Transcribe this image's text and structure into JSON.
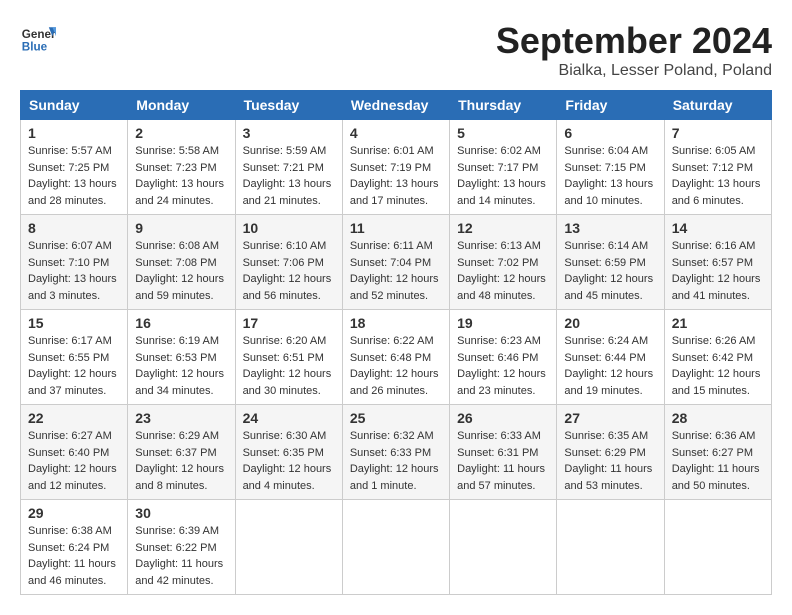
{
  "logo": {
    "general": "General",
    "blue": "Blue"
  },
  "header": {
    "month": "September 2024",
    "location": "Bialka, Lesser Poland, Poland"
  },
  "weekdays": [
    "Sunday",
    "Monday",
    "Tuesday",
    "Wednesday",
    "Thursday",
    "Friday",
    "Saturday"
  ],
  "weeks": [
    [
      {
        "day": "1",
        "info": "Sunrise: 5:57 AM\nSunset: 7:25 PM\nDaylight: 13 hours\nand 28 minutes."
      },
      {
        "day": "2",
        "info": "Sunrise: 5:58 AM\nSunset: 7:23 PM\nDaylight: 13 hours\nand 24 minutes."
      },
      {
        "day": "3",
        "info": "Sunrise: 5:59 AM\nSunset: 7:21 PM\nDaylight: 13 hours\nand 21 minutes."
      },
      {
        "day": "4",
        "info": "Sunrise: 6:01 AM\nSunset: 7:19 PM\nDaylight: 13 hours\nand 17 minutes."
      },
      {
        "day": "5",
        "info": "Sunrise: 6:02 AM\nSunset: 7:17 PM\nDaylight: 13 hours\nand 14 minutes."
      },
      {
        "day": "6",
        "info": "Sunrise: 6:04 AM\nSunset: 7:15 PM\nDaylight: 13 hours\nand 10 minutes."
      },
      {
        "day": "7",
        "info": "Sunrise: 6:05 AM\nSunset: 7:12 PM\nDaylight: 13 hours\nand 6 minutes."
      }
    ],
    [
      {
        "day": "8",
        "info": "Sunrise: 6:07 AM\nSunset: 7:10 PM\nDaylight: 13 hours\nand 3 minutes."
      },
      {
        "day": "9",
        "info": "Sunrise: 6:08 AM\nSunset: 7:08 PM\nDaylight: 12 hours\nand 59 minutes."
      },
      {
        "day": "10",
        "info": "Sunrise: 6:10 AM\nSunset: 7:06 PM\nDaylight: 12 hours\nand 56 minutes."
      },
      {
        "day": "11",
        "info": "Sunrise: 6:11 AM\nSunset: 7:04 PM\nDaylight: 12 hours\nand 52 minutes."
      },
      {
        "day": "12",
        "info": "Sunrise: 6:13 AM\nSunset: 7:02 PM\nDaylight: 12 hours\nand 48 minutes."
      },
      {
        "day": "13",
        "info": "Sunrise: 6:14 AM\nSunset: 6:59 PM\nDaylight: 12 hours\nand 45 minutes."
      },
      {
        "day": "14",
        "info": "Sunrise: 6:16 AM\nSunset: 6:57 PM\nDaylight: 12 hours\nand 41 minutes."
      }
    ],
    [
      {
        "day": "15",
        "info": "Sunrise: 6:17 AM\nSunset: 6:55 PM\nDaylight: 12 hours\nand 37 minutes."
      },
      {
        "day": "16",
        "info": "Sunrise: 6:19 AM\nSunset: 6:53 PM\nDaylight: 12 hours\nand 34 minutes."
      },
      {
        "day": "17",
        "info": "Sunrise: 6:20 AM\nSunset: 6:51 PM\nDaylight: 12 hours\nand 30 minutes."
      },
      {
        "day": "18",
        "info": "Sunrise: 6:22 AM\nSunset: 6:48 PM\nDaylight: 12 hours\nand 26 minutes."
      },
      {
        "day": "19",
        "info": "Sunrise: 6:23 AM\nSunset: 6:46 PM\nDaylight: 12 hours\nand 23 minutes."
      },
      {
        "day": "20",
        "info": "Sunrise: 6:24 AM\nSunset: 6:44 PM\nDaylight: 12 hours\nand 19 minutes."
      },
      {
        "day": "21",
        "info": "Sunrise: 6:26 AM\nSunset: 6:42 PM\nDaylight: 12 hours\nand 15 minutes."
      }
    ],
    [
      {
        "day": "22",
        "info": "Sunrise: 6:27 AM\nSunset: 6:40 PM\nDaylight: 12 hours\nand 12 minutes."
      },
      {
        "day": "23",
        "info": "Sunrise: 6:29 AM\nSunset: 6:37 PM\nDaylight: 12 hours\nand 8 minutes."
      },
      {
        "day": "24",
        "info": "Sunrise: 6:30 AM\nSunset: 6:35 PM\nDaylight: 12 hours\nand 4 minutes."
      },
      {
        "day": "25",
        "info": "Sunrise: 6:32 AM\nSunset: 6:33 PM\nDaylight: 12 hours\nand 1 minute."
      },
      {
        "day": "26",
        "info": "Sunrise: 6:33 AM\nSunset: 6:31 PM\nDaylight: 11 hours\nand 57 minutes."
      },
      {
        "day": "27",
        "info": "Sunrise: 6:35 AM\nSunset: 6:29 PM\nDaylight: 11 hours\nand 53 minutes."
      },
      {
        "day": "28",
        "info": "Sunrise: 6:36 AM\nSunset: 6:27 PM\nDaylight: 11 hours\nand 50 minutes."
      }
    ],
    [
      {
        "day": "29",
        "info": "Sunrise: 6:38 AM\nSunset: 6:24 PM\nDaylight: 11 hours\nand 46 minutes."
      },
      {
        "day": "30",
        "info": "Sunrise: 6:39 AM\nSunset: 6:22 PM\nDaylight: 11 hours\nand 42 minutes."
      },
      {
        "day": "",
        "info": ""
      },
      {
        "day": "",
        "info": ""
      },
      {
        "day": "",
        "info": ""
      },
      {
        "day": "",
        "info": ""
      },
      {
        "day": "",
        "info": ""
      }
    ]
  ]
}
